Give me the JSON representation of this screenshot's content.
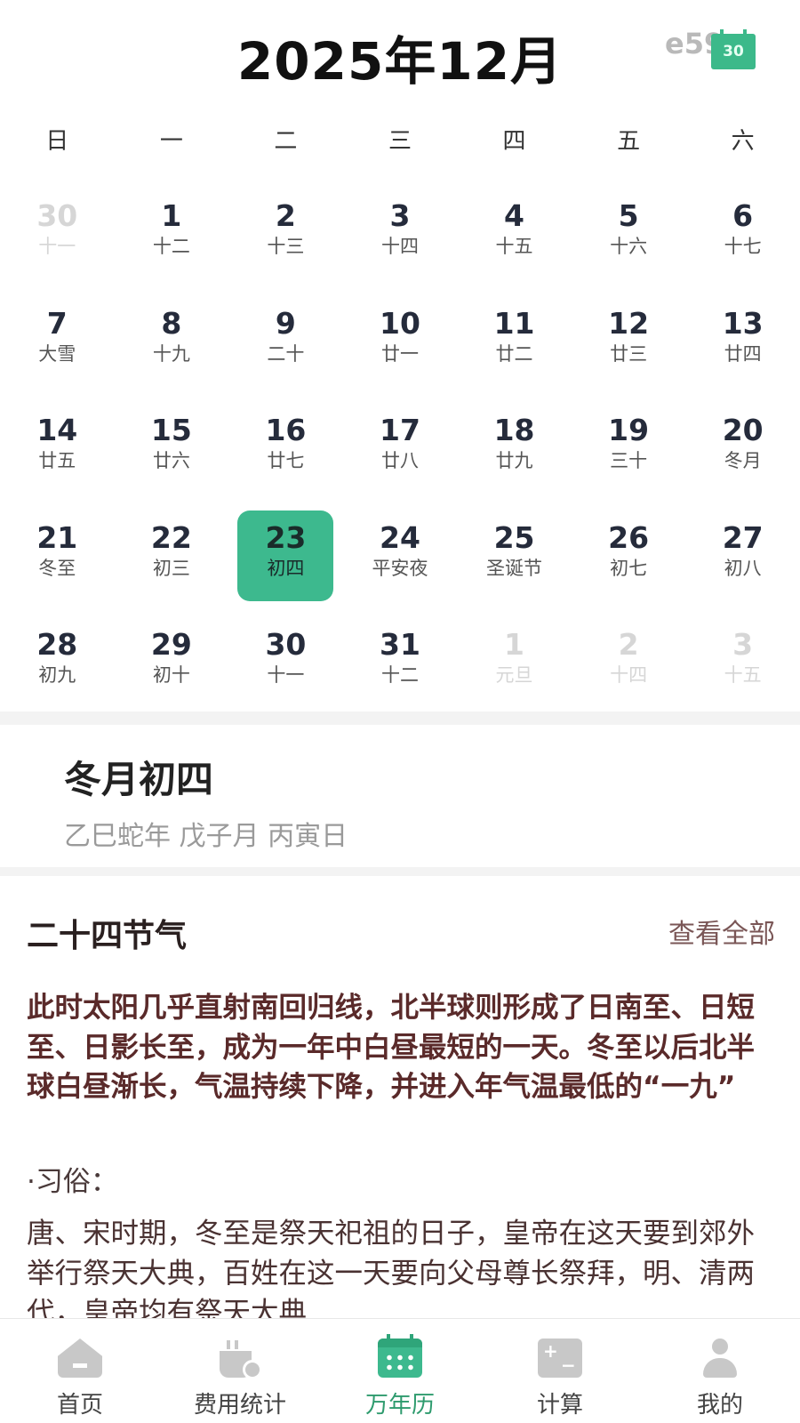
{
  "header": {
    "month_title": "2025年12月",
    "watermark": "e59",
    "today_button": "30"
  },
  "weekdays": [
    "日",
    "一",
    "二",
    "三",
    "四",
    "五",
    "六"
  ],
  "calendar": {
    "weeks": [
      [
        {
          "day": "30",
          "lunar": "十一",
          "other": true
        },
        {
          "day": "1",
          "lunar": "十二"
        },
        {
          "day": "2",
          "lunar": "十三"
        },
        {
          "day": "3",
          "lunar": "十四"
        },
        {
          "day": "4",
          "lunar": "十五"
        },
        {
          "day": "5",
          "lunar": "十六"
        },
        {
          "day": "6",
          "lunar": "十七"
        }
      ],
      [
        {
          "day": "7",
          "lunar": "大雪"
        },
        {
          "day": "8",
          "lunar": "十九"
        },
        {
          "day": "9",
          "lunar": "二十"
        },
        {
          "day": "10",
          "lunar": "廿一"
        },
        {
          "day": "11",
          "lunar": "廿二"
        },
        {
          "day": "12",
          "lunar": "廿三"
        },
        {
          "day": "13",
          "lunar": "廿四"
        }
      ],
      [
        {
          "day": "14",
          "lunar": "廿五"
        },
        {
          "day": "15",
          "lunar": "廿六"
        },
        {
          "day": "16",
          "lunar": "廿七"
        },
        {
          "day": "17",
          "lunar": "廿八"
        },
        {
          "day": "18",
          "lunar": "廿九"
        },
        {
          "day": "19",
          "lunar": "三十"
        },
        {
          "day": "20",
          "lunar": "冬月"
        }
      ],
      [
        {
          "day": "21",
          "lunar": "冬至"
        },
        {
          "day": "22",
          "lunar": "初三"
        },
        {
          "day": "23",
          "lunar": "初四",
          "selected": true
        },
        {
          "day": "24",
          "lunar": "平安夜"
        },
        {
          "day": "25",
          "lunar": "圣诞节"
        },
        {
          "day": "26",
          "lunar": "初七"
        },
        {
          "day": "27",
          "lunar": "初八"
        }
      ],
      [
        {
          "day": "28",
          "lunar": "初九"
        },
        {
          "day": "29",
          "lunar": "初十"
        },
        {
          "day": "30",
          "lunar": "十一"
        },
        {
          "day": "31",
          "lunar": "十二"
        },
        {
          "day": "1",
          "lunar": "元旦",
          "other": true
        },
        {
          "day": "2",
          "lunar": "十四",
          "other": true
        },
        {
          "day": "3",
          "lunar": "十五",
          "other": true
        }
      ]
    ]
  },
  "selected_date": {
    "lunar_title": "冬月初四",
    "ganzhi": "乙巳蛇年 戊子月 丙寅日"
  },
  "solar_term": {
    "header": "二十四节气",
    "view_all": "查看全部",
    "description": "此时太阳几乎直射南回归线，北半球则形成了日南至、日短至、日影长至，成为一年中白昼最短的一天。冬至以后北半球白昼渐长，气温持续下降，并进入年气温最低的“一九”",
    "customs_label": "·习俗：",
    "customs_text": "唐、宋时期，冬至是祭天祀祖的日子，皇帝在这天要到郊外举行祭天大典，百姓在这一天要向父母尊长祭拜，明、清两代，皇帝均有祭天大典"
  },
  "tabbar": {
    "tabs": [
      {
        "label": "首页",
        "icon": "home-icon"
      },
      {
        "label": "费用统计",
        "icon": "expense-icon"
      },
      {
        "label": "万年历",
        "icon": "calendar-icon",
        "active": true
      },
      {
        "label": "计算",
        "icon": "calculator-icon"
      },
      {
        "label": "我的",
        "icon": "user-icon"
      }
    ]
  },
  "colors": {
    "accent": "#3db98e",
    "accent_text": "#2e9b6e",
    "muted_day": "#d6d6d6",
    "solar_text": "#5a2a2a"
  }
}
